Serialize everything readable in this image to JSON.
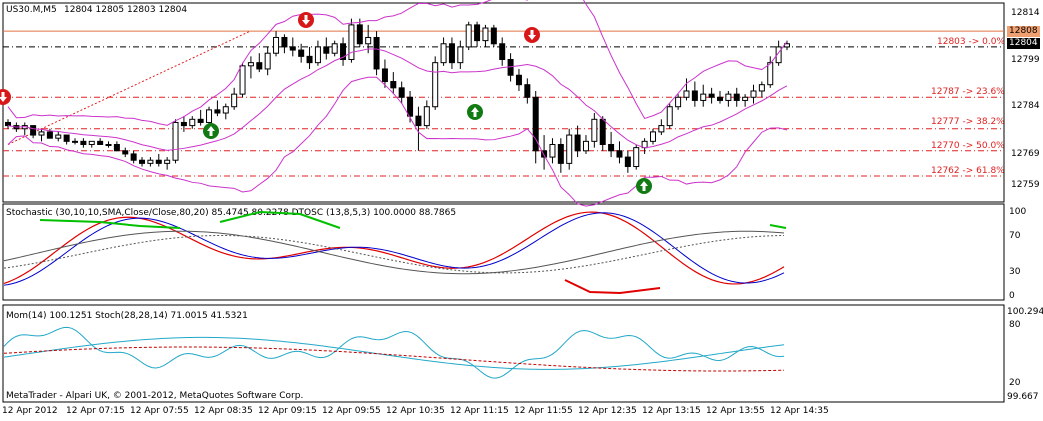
{
  "chart_header": {
    "symbol": "US30.M,M5",
    "ohlc": "12804 12805 12803 12804"
  },
  "copyright": "MetaTrader - Alpari UK, © 2001-2012, MetaQuotes Software Corp.",
  "colors": {
    "bollinger": "#cc33cc",
    "fibo": "#e02020",
    "candle": "#000000",
    "arrow_up": "#127a12",
    "arrow_down": "#d81818",
    "stoch_main": "#e00000",
    "stoch_blue": "#0000cc",
    "stoch_green": "#00c000",
    "mom": "#22a8c8",
    "stoch2_signal": "#c00000"
  },
  "price_axis": {
    "ticks": [
      "12814",
      "12799",
      "12784",
      "12769",
      "12759"
    ],
    "current_price_red": "12808",
    "current_price_black": "12804"
  },
  "fibo_levels": [
    {
      "label": "12803 -> 0.0%"
    },
    {
      "label": "12787 -> 23.6%"
    },
    {
      "label": "12777 -> 38.2%"
    },
    {
      "label": "12770 -> 50.0%"
    },
    {
      "label": "12762 -> 61.8%"
    }
  ],
  "indicator1": {
    "title": "Stochastic (30,10,10,SMA,Close/Close,80,20) 85.4745 80.2278  DTOSC (13,8,5,3) 100.0000 88.7865",
    "ticks": [
      "100",
      "70",
      "30",
      "0"
    ]
  },
  "indicator2": {
    "title": "Mom(14) 100.1251  Stoch(28,28,14) 71.0015 41.5321",
    "ticks": [
      "100.294",
      "80",
      "20",
      "99.667"
    ]
  },
  "time_axis": [
    "12 Apr 2012",
    "12 Apr 07:15",
    "12 Apr 07:55",
    "12 Apr 08:35",
    "12 Apr 09:15",
    "12 Apr 09:55",
    "12 Apr 10:35",
    "12 Apr 11:15",
    "12 Apr 11:55",
    "12 Apr 12:35",
    "12 Apr 13:15",
    "12 Apr 13:55",
    "12 Apr 14:35"
  ],
  "chart_data": {
    "type": "candlestick",
    "title": "US30.M,M5",
    "x": [
      "12 Apr 2012",
      "12 Apr 07:15",
      "12 Apr 07:55",
      "12 Apr 08:35",
      "12 Apr 09:15",
      "12 Apr 09:55",
      "12 Apr 10:35",
      "12 Apr 11:15",
      "12 Apr 11:55",
      "12 Apr 12:35",
      "12 Apr 13:15",
      "12 Apr 13:55",
      "12 Apr 14:35"
    ],
    "ylim": [
      12755,
      12816
    ],
    "candles": [
      [
        12779,
        12780,
        12777,
        12778
      ],
      [
        12778,
        12779,
        12776,
        12777
      ],
      [
        12777,
        12779,
        12775,
        12778
      ],
      [
        12778,
        12778,
        12774,
        12775
      ],
      [
        12775,
        12777,
        12773,
        12776
      ],
      [
        12776,
        12777,
        12774,
        12774
      ],
      [
        12774,
        12776,
        12773,
        12775
      ],
      [
        12775,
        12775,
        12772,
        12773
      ],
      [
        12773,
        12774,
        12772,
        12773
      ],
      [
        12773,
        12774,
        12771,
        12772
      ],
      [
        12772,
        12773,
        12771,
        12773
      ],
      [
        12773,
        12774,
        12772,
        12772
      ],
      [
        12772,
        12773,
        12771,
        12772
      ],
      [
        12772,
        12773,
        12770,
        12770
      ],
      [
        12770,
        12771,
        12768,
        12769
      ],
      [
        12769,
        12770,
        12766,
        12767
      ],
      [
        12767,
        12768,
        12765,
        12766
      ],
      [
        12766,
        12768,
        12765,
        12767
      ],
      [
        12767,
        12769,
        12765,
        12766
      ],
      [
        12766,
        12768,
        12764,
        12767
      ],
      [
        12767,
        12780,
        12766,
        12779
      ],
      [
        12779,
        12781,
        12776,
        12778
      ],
      [
        12778,
        12781,
        12777,
        12780
      ],
      [
        12780,
        12783,
        12778,
        12779
      ],
      [
        12779,
        12784,
        12778,
        12783
      ],
      [
        12783,
        12786,
        12781,
        12782
      ],
      [
        12782,
        12785,
        12780,
        12784
      ],
      [
        12784,
        12790,
        12783,
        12788
      ],
      [
        12788,
        12798,
        12787,
        12797
      ],
      [
        12797,
        12800,
        12793,
        12798
      ],
      [
        12798,
        12801,
        12795,
        12796
      ],
      [
        12796,
        12803,
        12794,
        12801
      ],
      [
        12801,
        12808,
        12800,
        12806
      ],
      [
        12806,
        12807,
        12801,
        12803
      ],
      [
        12803,
        12806,
        12800,
        12802
      ],
      [
        12802,
        12804,
        12798,
        12800
      ],
      [
        12800,
        12803,
        12796,
        12798
      ],
      [
        12798,
        12805,
        12797,
        12803
      ],
      [
        12803,
        12806,
        12799,
        12801
      ],
      [
        12801,
        12805,
        12800,
        12804
      ],
      [
        12804,
        12806,
        12797,
        12799
      ],
      [
        12799,
        12812,
        12798,
        12810
      ],
      [
        12810,
        12812,
        12803,
        12804
      ],
      [
        12804,
        12810,
        12801,
        12806
      ],
      [
        12806,
        12808,
        12794,
        12796
      ],
      [
        12796,
        12799,
        12790,
        12792
      ],
      [
        12792,
        12795,
        12788,
        12790
      ],
      [
        12790,
        12792,
        12785,
        12787
      ],
      [
        12787,
        12789,
        12779,
        12781
      ],
      [
        12781,
        12784,
        12770,
        12778
      ],
      [
        12778,
        12786,
        12777,
        12784
      ],
      [
        12784,
        12800,
        12783,
        12798
      ],
      [
        12798,
        12806,
        12797,
        12804
      ],
      [
        12804,
        12806,
        12796,
        12798
      ],
      [
        12798,
        12805,
        12796,
        12803
      ],
      [
        12803,
        12811,
        12802,
        12810
      ],
      [
        12810,
        12811,
        12803,
        12805
      ],
      [
        12805,
        12810,
        12803,
        12809
      ],
      [
        12809,
        12810,
        12803,
        12804
      ],
      [
        12804,
        12806,
        12797,
        12799
      ],
      [
        12799,
        12801,
        12792,
        12794
      ],
      [
        12794,
        12796,
        12789,
        12791
      ],
      [
        12791,
        12793,
        12785,
        12787
      ],
      [
        12787,
        12789,
        12766,
        12770
      ],
      [
        12770,
        12775,
        12764,
        12768
      ],
      [
        12768,
        12774,
        12766,
        12772
      ],
      [
        12772,
        12774,
        12763,
        12766
      ],
      [
        12766,
        12777,
        12764,
        12775
      ],
      [
        12775,
        12778,
        12768,
        12770
      ],
      [
        12770,
        12775,
        12769,
        12773
      ],
      [
        12773,
        12782,
        12771,
        12780
      ],
      [
        12780,
        12781,
        12770,
        12772
      ],
      [
        12772,
        12776,
        12768,
        12770
      ],
      [
        12770,
        12773,
        12766,
        12768
      ],
      [
        12768,
        12770,
        12763,
        12765
      ],
      [
        12765,
        12772,
        12764,
        12771
      ],
      [
        12771,
        12774,
        12769,
        12773
      ],
      [
        12773,
        12777,
        12772,
        12776
      ],
      [
        12776,
        12780,
        12775,
        12778
      ],
      [
        12778,
        12785,
        12777,
        12784
      ],
      [
        12784,
        12788,
        12783,
        12787
      ],
      [
        12787,
        12793,
        12786,
        12789
      ],
      [
        12789,
        12792,
        12784,
        12786
      ],
      [
        12786,
        12791,
        12784,
        12788
      ],
      [
        12788,
        12790,
        12785,
        12787
      ],
      [
        12787,
        12789,
        12785,
        12786
      ],
      [
        12786,
        12789,
        12784,
        12788
      ],
      [
        12788,
        12790,
        12784,
        12786
      ],
      [
        12786,
        12788,
        12784,
        12787
      ],
      [
        12787,
        12791,
        12785,
        12789
      ],
      [
        12789,
        12792,
        12787,
        12791
      ],
      [
        12791,
        12800,
        12790,
        12798
      ],
      [
        12798,
        12805,
        12797,
        12803
      ],
      [
        12803,
        12805,
        12802,
        12804
      ]
    ]
  }
}
